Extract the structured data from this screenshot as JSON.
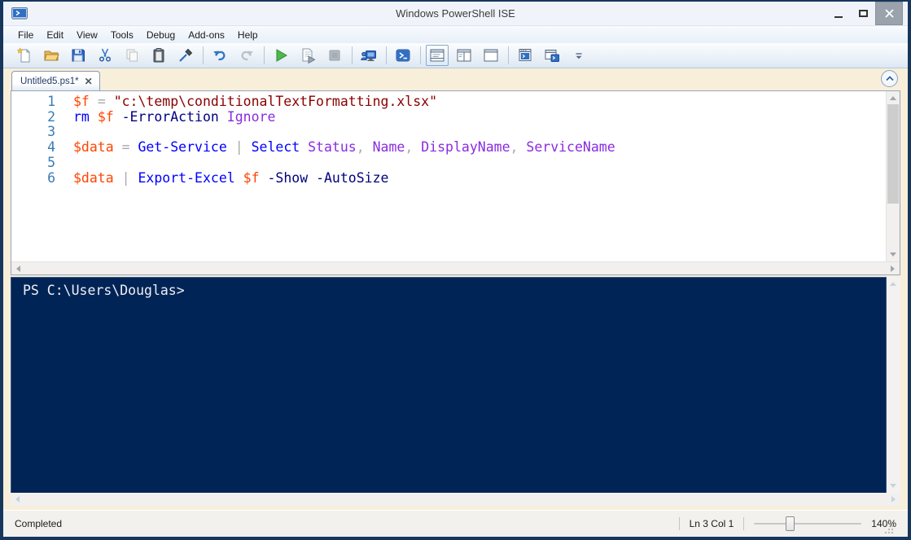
{
  "window": {
    "title": "Windows PowerShell ISE"
  },
  "menu": {
    "items": [
      "File",
      "Edit",
      "View",
      "Tools",
      "Debug",
      "Add-ons",
      "Help"
    ]
  },
  "toolbar": {
    "buttons": [
      {
        "name": "new-script",
        "icon": "new-script-icon"
      },
      {
        "name": "open-script",
        "icon": "open-icon"
      },
      {
        "name": "save",
        "icon": "save-icon"
      },
      {
        "name": "cut",
        "icon": "cut-icon"
      },
      {
        "name": "copy",
        "icon": "copy-icon",
        "disabled": true
      },
      {
        "name": "paste",
        "icon": "paste-icon"
      },
      {
        "name": "clear-console-pane",
        "icon": "clear-console-icon"
      },
      {
        "sep": true
      },
      {
        "name": "undo",
        "icon": "undo-icon"
      },
      {
        "name": "redo",
        "icon": "redo-icon",
        "disabled": true
      },
      {
        "sep": true
      },
      {
        "name": "run-script",
        "icon": "run-icon"
      },
      {
        "name": "run-selection",
        "icon": "run-selection-icon"
      },
      {
        "name": "stop-operation",
        "icon": "stop-icon",
        "disabled": true
      },
      {
        "sep": true
      },
      {
        "name": "new-remote-powershell-tab",
        "icon": "remote-tab-icon"
      },
      {
        "sep": true
      },
      {
        "name": "start-powershell-exe",
        "icon": "powershell-icon"
      },
      {
        "sep": true
      },
      {
        "name": "show-script-pane-top",
        "icon": "layout-top-icon",
        "selected": true
      },
      {
        "name": "show-script-pane-right",
        "icon": "layout-right-icon"
      },
      {
        "name": "show-script-pane-maximized",
        "icon": "layout-max-icon"
      },
      {
        "sep": true
      },
      {
        "name": "new-powershell-tab",
        "icon": "powershell-tab-icon"
      },
      {
        "name": "powershell-window",
        "icon": "powershell-window-icon"
      },
      {
        "name": "toolbar-overflow",
        "icon": "overflow-icon"
      }
    ]
  },
  "tab": {
    "label": "Untitled5.ps1*",
    "close": "✕"
  },
  "editor": {
    "lines": [
      {
        "num": "1",
        "tokens": [
          [
            "variable",
            "$f"
          ],
          [
            "plain",
            " "
          ],
          [
            "operator",
            "="
          ],
          [
            "plain",
            " "
          ],
          [
            "string",
            "\"c:\\temp\\conditionalTextFormatting.xlsx\""
          ]
        ]
      },
      {
        "num": "2",
        "tokens": [
          [
            "command",
            "rm"
          ],
          [
            "plain",
            " "
          ],
          [
            "variable",
            "$f"
          ],
          [
            "plain",
            " "
          ],
          [
            "parameter",
            "-ErrorAction"
          ],
          [
            "plain",
            " "
          ],
          [
            "argument",
            "Ignore"
          ]
        ]
      },
      {
        "num": "3",
        "tokens": []
      },
      {
        "num": "4",
        "tokens": [
          [
            "variable",
            "$data"
          ],
          [
            "plain",
            " "
          ],
          [
            "operator",
            "="
          ],
          [
            "plain",
            " "
          ],
          [
            "command",
            "Get-Service"
          ],
          [
            "plain",
            " "
          ],
          [
            "operator",
            "|"
          ],
          [
            "plain",
            " "
          ],
          [
            "command",
            "Select"
          ],
          [
            "plain",
            " "
          ],
          [
            "argument",
            "Status"
          ],
          [
            "operator",
            ","
          ],
          [
            "plain",
            " "
          ],
          [
            "argument",
            "Name"
          ],
          [
            "operator",
            ","
          ],
          [
            "plain",
            " "
          ],
          [
            "argument",
            "DisplayName"
          ],
          [
            "operator",
            ","
          ],
          [
            "plain",
            " "
          ],
          [
            "argument",
            "ServiceName"
          ]
        ]
      },
      {
        "num": "5",
        "tokens": []
      },
      {
        "num": "6",
        "tokens": [
          [
            "variable",
            "$data"
          ],
          [
            "plain",
            " "
          ],
          [
            "operator",
            "|"
          ],
          [
            "plain",
            " "
          ],
          [
            "command",
            "Export-Excel"
          ],
          [
            "plain",
            " "
          ],
          [
            "variable",
            "$f"
          ],
          [
            "plain",
            " "
          ],
          [
            "parameter",
            "-Show"
          ],
          [
            "plain",
            " "
          ],
          [
            "parameter",
            "-AutoSize"
          ]
        ]
      }
    ]
  },
  "console": {
    "lines": [
      "PS C:\\Users\\Douglas>"
    ]
  },
  "status": {
    "message": "Completed",
    "position": "Ln 3  Col 1",
    "zoom": "140%",
    "slider_position_pct": 33
  },
  "colors": {
    "window_border": "#16365c",
    "console_bg": "#012456",
    "variable": "#ff4500",
    "command": "#0000ff",
    "parameter": "#000080",
    "argument": "#8a2be2",
    "string": "#8b0000",
    "operator": "#a9a9a9",
    "line_number": "#3a7bb5"
  }
}
